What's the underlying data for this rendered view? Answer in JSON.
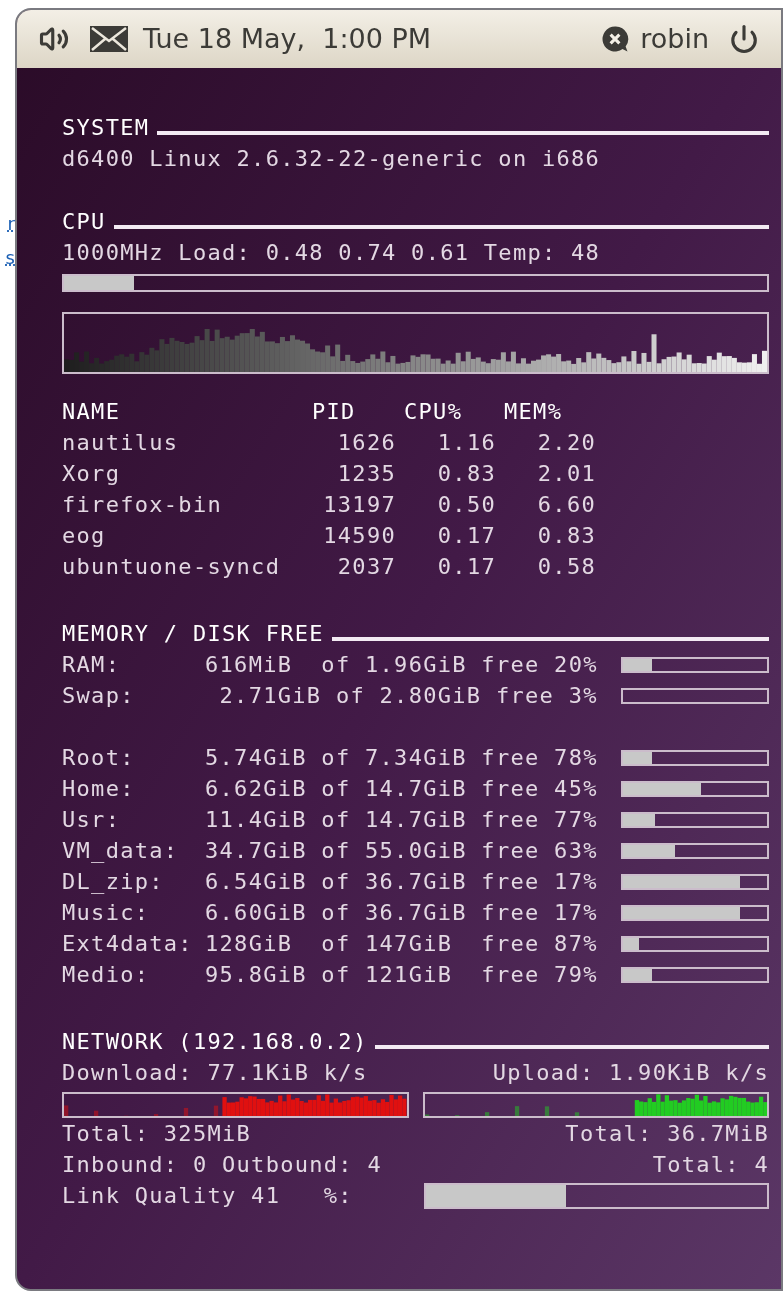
{
  "background_link_fragments": [
    "r",
    "s"
  ],
  "top_panel": {
    "date_time": "Tue 18 May,  1:00 PM",
    "user": "robin"
  },
  "system": {
    "title": "SYSTEM",
    "text": "d6400 Linux 2.6.32-22-generic on i686"
  },
  "cpu": {
    "title": "CPU",
    "info": "1000MHz Load: 0.48 0.74 0.61 Temp: 48",
    "usage": {
      "level": 0.1
    }
  },
  "processes": {
    "columns": [
      "NAME",
      "PID",
      "CPU%",
      "MEM%"
    ],
    "rows": [
      [
        "nautilus",
        "1626",
        "1.16",
        "2.20"
      ],
      [
        "Xorg",
        "1235",
        "0.83",
        "2.01"
      ],
      [
        "firefox-bin",
        "13197",
        "0.50",
        "6.60"
      ],
      [
        "eog",
        "14590",
        "0.17",
        "0.83"
      ],
      [
        "ubuntuone-syncd",
        "2037",
        "0.17",
        "0.58"
      ]
    ]
  },
  "memory": {
    "title": "MEMORY / DISK FREE",
    "groups": [
      [
        {
          "label": "RAM:",
          "value": "616MiB  of 1.96GiB free 20%",
          "level": 0.2
        },
        {
          "label": "Swap:",
          "value": " 2.71GiB of 2.80GiB free 3%",
          "level": 0
        }
      ],
      [
        {
          "label": "Root:",
          "value": "5.74GiB of 7.34GiB free 78%",
          "level": 0.2
        },
        {
          "label": "Home:",
          "value": "6.62GiB of 14.7GiB free 45%",
          "level": 0.54
        },
        {
          "label": "Usr:",
          "value": "11.4GiB of 14.7GiB free 77%",
          "level": 0.22
        },
        {
          "label": "VM_data:",
          "value": "34.7GiB of 55.0GiB free 63%",
          "level": 0.36
        },
        {
          "label": "DL_zip:",
          "value": "6.54GiB of 36.7GiB free 17%",
          "level": 0.81
        },
        {
          "label": "Music:",
          "value": "6.60GiB of 36.7GiB free 17%",
          "level": 0.81
        },
        {
          "label": "Ext4data:",
          "value": "128GiB  of 147GiB  free 87%",
          "level": 0.11
        },
        {
          "label": "Medio:",
          "value": "95.8GiB of 121GiB  free 79%",
          "level": 0.2
        }
      ]
    ]
  },
  "network": {
    "title": "NETWORK (192.168.0.2)",
    "download": "Download: 77.1KiB k/s",
    "upload": "Upload: 1.90KiB k/s",
    "download_total": "Total: 325MiB",
    "upload_total": "Total: 36.7MiB",
    "connections": "Inbound: 0 Outbound: 4",
    "connections_total": "Total: 4",
    "link_quality": {
      "label": "Link Quality 41   %:",
      "level": 0.41
    }
  }
}
